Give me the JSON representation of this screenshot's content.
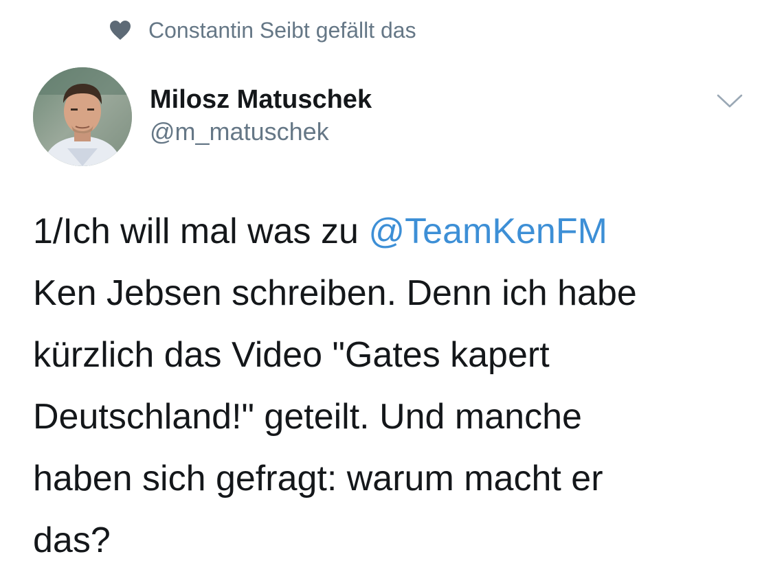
{
  "social_context": {
    "icon": "heart-icon",
    "text": "Constantin Seibt gefällt das"
  },
  "author": {
    "display_name": "Milosz Matuschek",
    "handle": "@m_matuschek"
  },
  "tweet": {
    "text_before_mention": "1/Ich will mal was zu ",
    "mention": "@TeamKenFM",
    "text_after_mention": "\nKen Jebsen schreiben.  Denn ich habe\nkürzlich das Video \"Gates kapert\nDeutschland!\" geteilt. Und manche\nhaben sich gefragt: warum macht er\ndas?"
  },
  "colors": {
    "secondary_text": "#657786",
    "link": "#3d8fd6",
    "primary_text": "#14171a"
  }
}
